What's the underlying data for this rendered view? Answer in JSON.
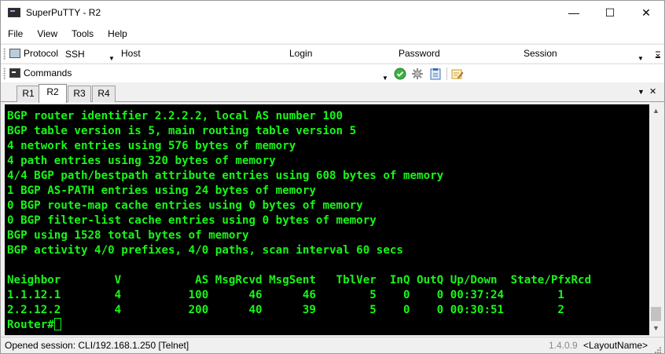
{
  "window": {
    "title": "SuperPuTTY - R2",
    "minimize": "—",
    "maximize": "☐",
    "close": "✕"
  },
  "menu": [
    "File",
    "View",
    "Tools",
    "Help"
  ],
  "connection_toolbar": {
    "protocol_label": "Protocol",
    "protocol_value": "SSH",
    "host_label": "Host",
    "host_value": "",
    "login_label": "Login",
    "login_value": "",
    "password_label": "Password",
    "password_value": "",
    "session_label": "Session",
    "session_value": ""
  },
  "commands_toolbar": {
    "label": "Commands",
    "value": ""
  },
  "tabs": [
    {
      "label": "R1",
      "active": false
    },
    {
      "label": "R2",
      "active": true
    },
    {
      "label": "R3",
      "active": false
    },
    {
      "label": "R4",
      "active": false
    }
  ],
  "tab_controls": {
    "dropdown": "▼",
    "close": "✕"
  },
  "terminal": {
    "lines": [
      "BGP router identifier 2.2.2.2, local AS number 100",
      "BGP table version is 5, main routing table version 5",
      "4 network entries using 576 bytes of memory",
      "4 path entries using 320 bytes of memory",
      "4/4 BGP path/bestpath attribute entries using 608 bytes of memory",
      "1 BGP AS-PATH entries using 24 bytes of memory",
      "0 BGP route-map cache entries using 0 bytes of memory",
      "0 BGP filter-list cache entries using 0 bytes of memory",
      "BGP using 1528 total bytes of memory",
      "BGP activity 4/0 prefixes, 4/0 paths, scan interval 60 secs",
      "",
      "Neighbor        V           AS MsgRcvd MsgSent   TblVer  InQ OutQ Up/Down  State/PfxRcd",
      "1.1.12.1        4          100      46      46        5    0    0 00:37:24        1",
      "2.2.12.2        4          200      40      39        5    0    0 00:30:51        2"
    ],
    "prompt": "Router#"
  },
  "statusbar": {
    "text": "Opened session: CLI/192.168.1.250 [Telnet]",
    "version": "1.4.0.9",
    "layout": "<LayoutName>"
  },
  "colors": {
    "terminal_bg": "#000000",
    "terminal_fg": "#19f519"
  }
}
